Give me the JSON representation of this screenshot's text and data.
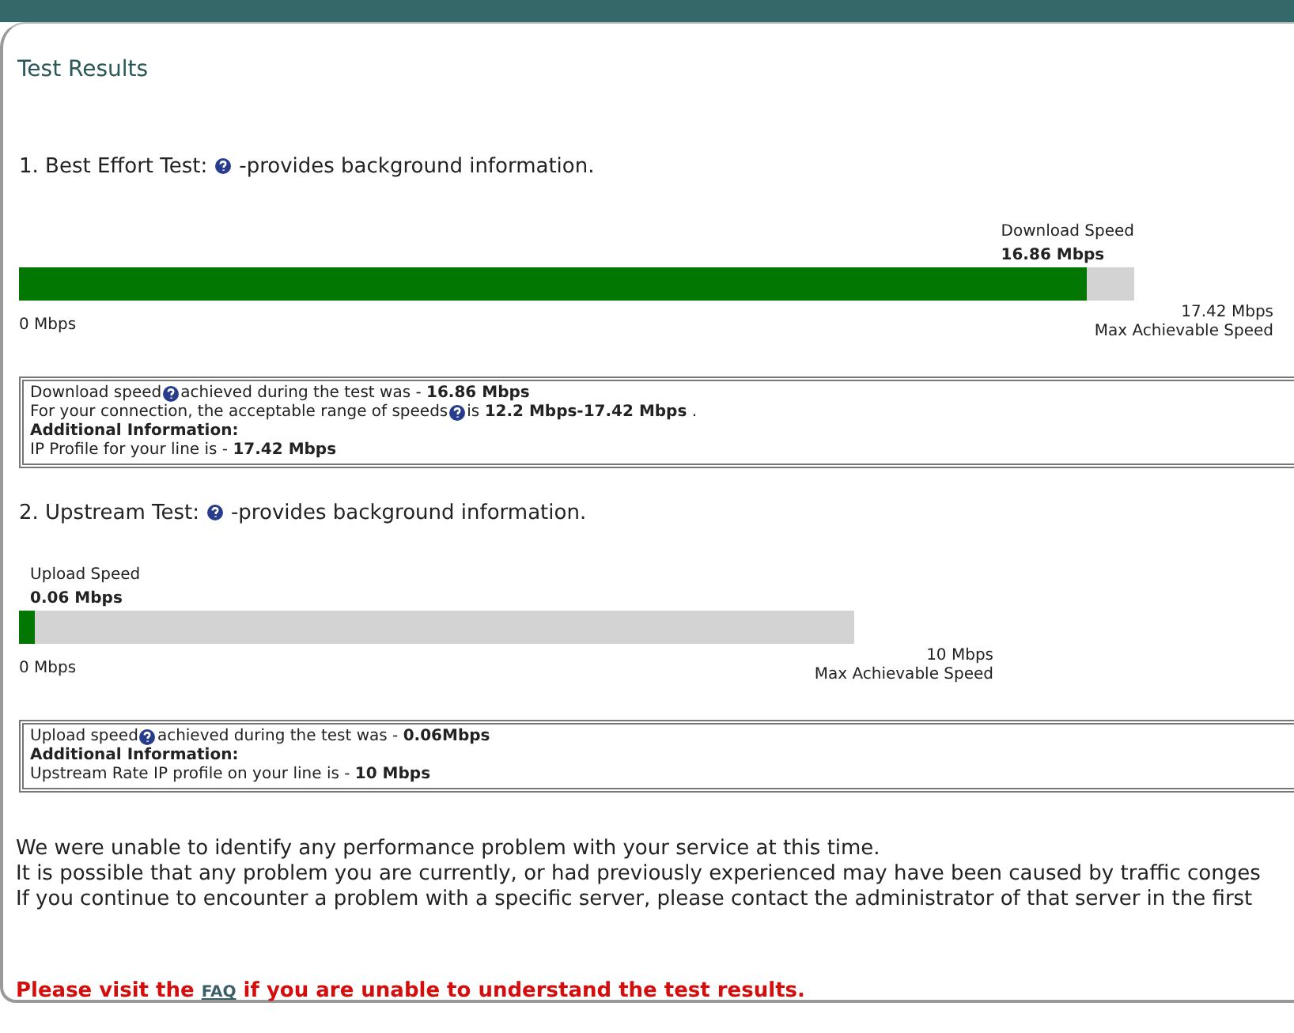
{
  "title": "Test Results",
  "tests": [
    {
      "number": "1.",
      "name": "Best Effort Test:",
      "help_text": "-provides background information.",
      "gauge": {
        "label": "Download Speed",
        "value": "16.86 Mbps",
        "level": 0.958,
        "min": "0 Mbps",
        "max": "17.42 Mbps",
        "max_caption": "Max Achievable Speed"
      },
      "info": [
        {
          "kind": "plain",
          "segments": [
            "Download speed",
            "achieved during the test was - **16.86 Mbps**"
          ]
        },
        {
          "kind": "plain",
          "segments": [
            "For your connection, the acceptable range of speeds",
            "is **12.2 Mbps-17.42 Mbps** ."
          ]
        },
        {
          "kind": "heading",
          "segments": [
            "Additional Information:"
          ]
        },
        {
          "kind": "plain",
          "segments": [
            "IP Profile for your line is - **17.42 Mbps**"
          ]
        }
      ]
    },
    {
      "number": "2.",
      "name": "Upstream Test:",
      "help_text": "-provides background information.",
      "gauge": {
        "label": "Upload Speed",
        "value": "0.06 Mbps",
        "level": 0.019,
        "min": "0 Mbps",
        "max": "10 Mbps",
        "max_caption": "Max Achievable Speed"
      },
      "info": [
        {
          "kind": "plain",
          "segments": [
            "Upload speed",
            "achieved during the test was - **0.06Mbps**"
          ]
        },
        {
          "kind": "heading",
          "segments": [
            "Additional Information:"
          ]
        },
        {
          "kind": "plain",
          "segments": [
            "Upstream Rate IP profile on your line is - **10 Mbps**"
          ]
        }
      ]
    }
  ],
  "summary": [
    "We were unable to identify any performance problem with your service at this time.",
    "It is possible that any problem you are currently, or had previously experienced may have been caused by traffic conges",
    "If you continue to encounter a problem with a specific server, please contact the administrator of that server in the first"
  ],
  "notice": {
    "before": "Please visit the",
    "link": "FAQ",
    "after": "if you are unable to understand the test results."
  }
}
